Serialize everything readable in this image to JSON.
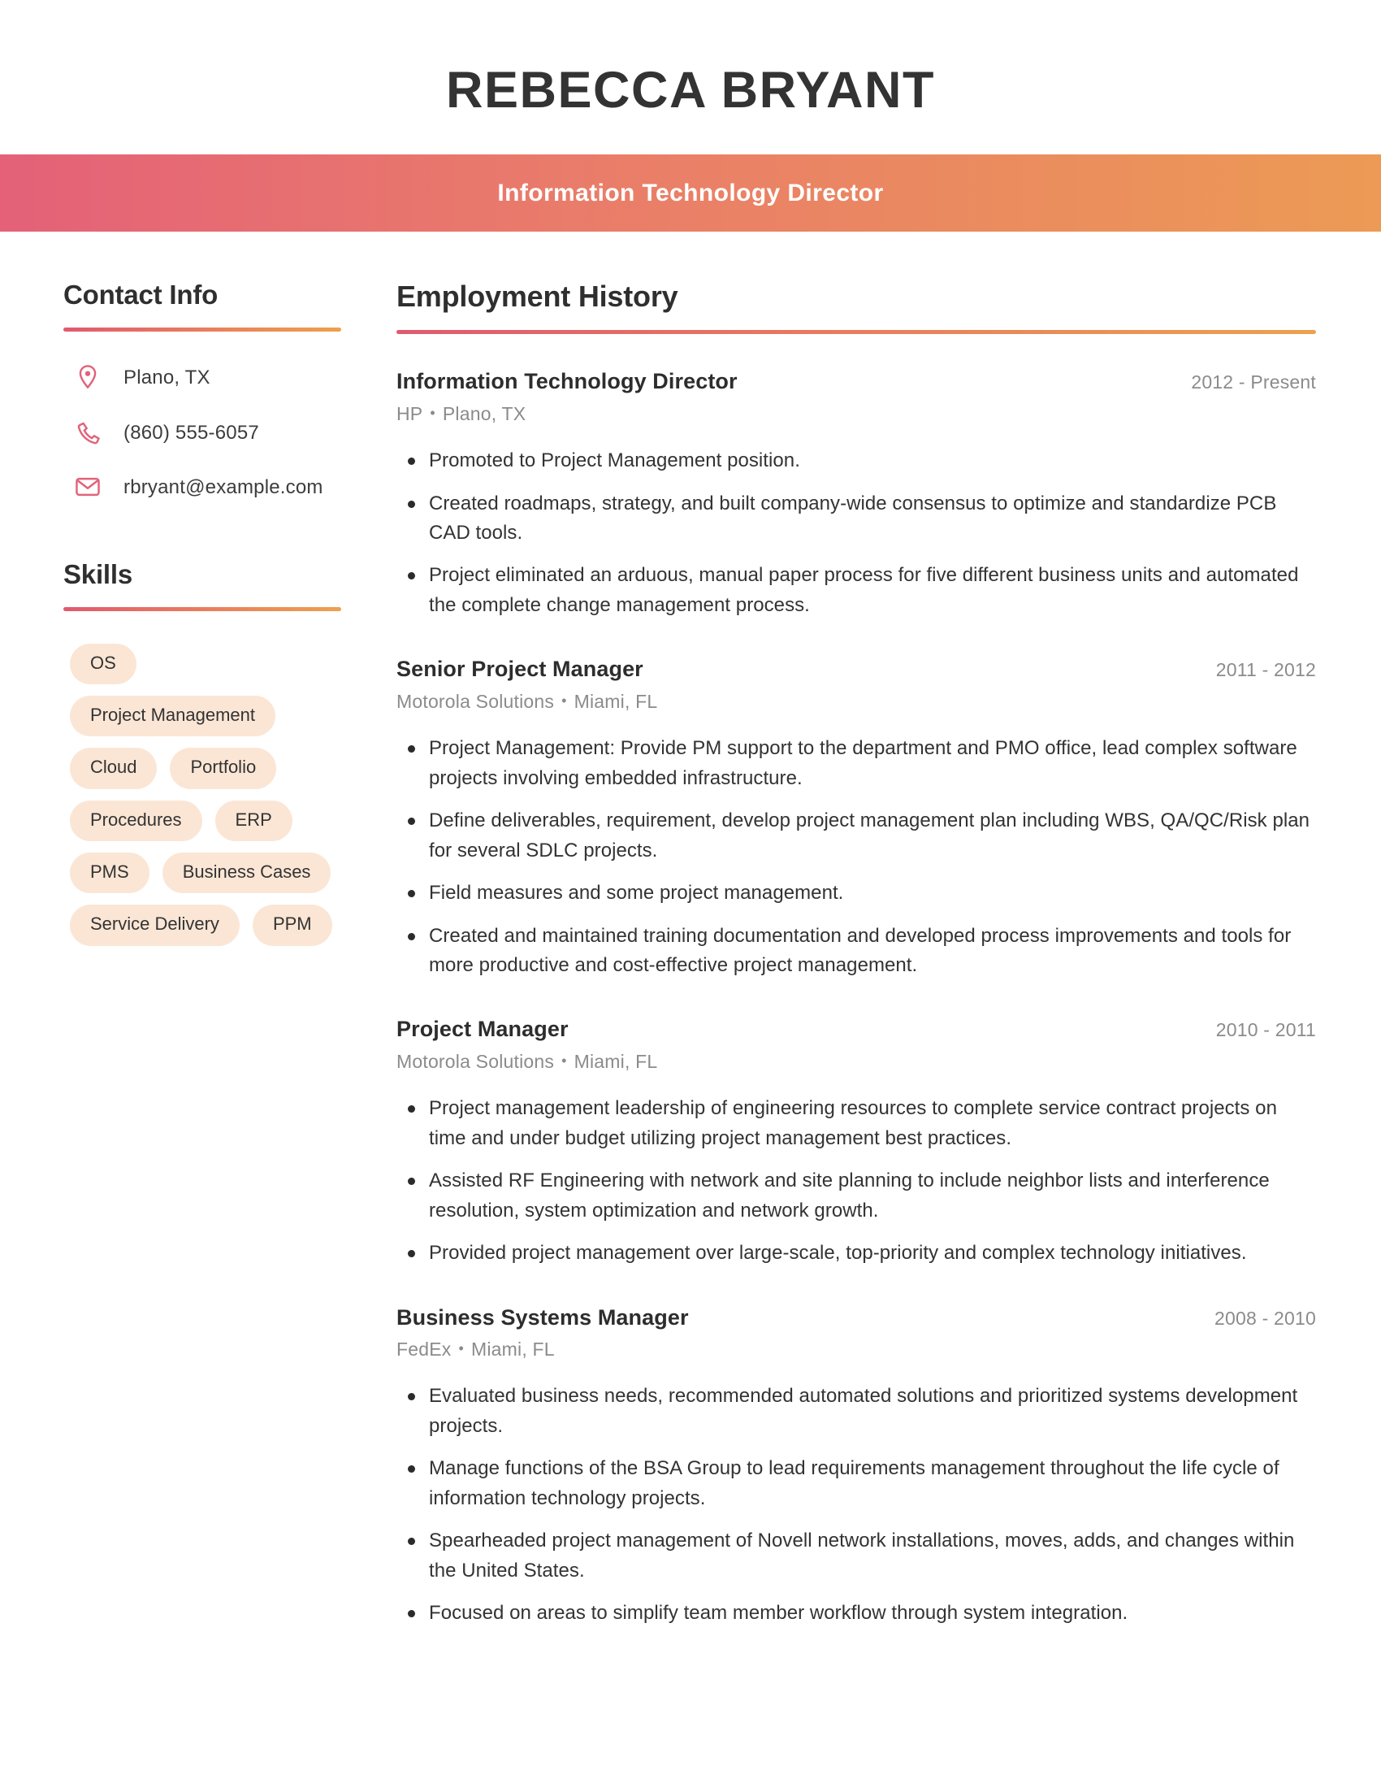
{
  "header": {
    "name": "REBECCA BRYANT",
    "job_title": "Information Technology Director",
    "band_color_left": "#e46178",
    "band_color_right": "#ec9a55"
  },
  "sidebar": {
    "contact": {
      "heading": "Contact Info",
      "items": [
        {
          "icon": "map-pin-icon",
          "text": "Plano, TX"
        },
        {
          "icon": "phone-icon",
          "text": "(860) 555-6057"
        },
        {
          "icon": "envelope-icon",
          "text": "rbryant@example.com"
        }
      ]
    },
    "skills": {
      "heading": "Skills",
      "pill_color": "#fbe6d5",
      "items": [
        "OS",
        "Project Management",
        "Cloud",
        "Portfolio",
        "Procedures",
        "ERP",
        "PMS",
        "Business Cases",
        "Service Delivery",
        "PPM"
      ]
    }
  },
  "main": {
    "heading": "Employment History",
    "jobs": [
      {
        "title": "Information Technology Director",
        "dates": "2012 - Present",
        "company": "HP",
        "location": "Plano, TX",
        "bullets": [
          "Promoted to Project Management position.",
          "Created roadmaps, strategy, and built company-wide consensus to optimize and standardize PCB CAD tools.",
          "Project eliminated an arduous, manual paper process for five different business units and automated the complete change management process."
        ]
      },
      {
        "title": "Senior Project Manager",
        "dates": "2011 - 2012",
        "company": "Motorola Solutions",
        "location": "Miami, FL",
        "bullets": [
          "Project Management: Provide PM support to the department and PMO office, lead complex software projects involving embedded infrastructure.",
          "Define deliverables, requirement, develop project management plan including WBS, QA/QC/Risk plan for several SDLC projects.",
          "Field measures and some project management.",
          "Created and maintained training documentation and developed process improvements and tools for more productive and cost-effective project management."
        ]
      },
      {
        "title": "Project Manager",
        "dates": "2010 - 2011",
        "company": "Motorola Solutions",
        "location": "Miami, FL",
        "bullets": [
          "Project management leadership of engineering resources to complete service contract projects on time and under budget utilizing project management best practices.",
          "Assisted RF Engineering with network and site planning to include neighbor lists and interference resolution, system optimization and network growth.",
          "Provided project management over large-scale, top-priority and complex technology initiatives."
        ]
      },
      {
        "title": "Business Systems Manager",
        "dates": "2008 - 2010",
        "company": "FedEx",
        "location": "Miami, FL",
        "bullets": [
          "Evaluated business needs, recommended automated solutions and prioritized systems development projects.",
          "Manage functions of the BSA Group to lead requirements management throughout the life cycle of information technology projects.",
          "Spearheaded project management of Novell network installations, moves, adds, and changes within the United States.",
          "Focused on areas to simplify team member workflow through system integration."
        ]
      }
    ]
  }
}
